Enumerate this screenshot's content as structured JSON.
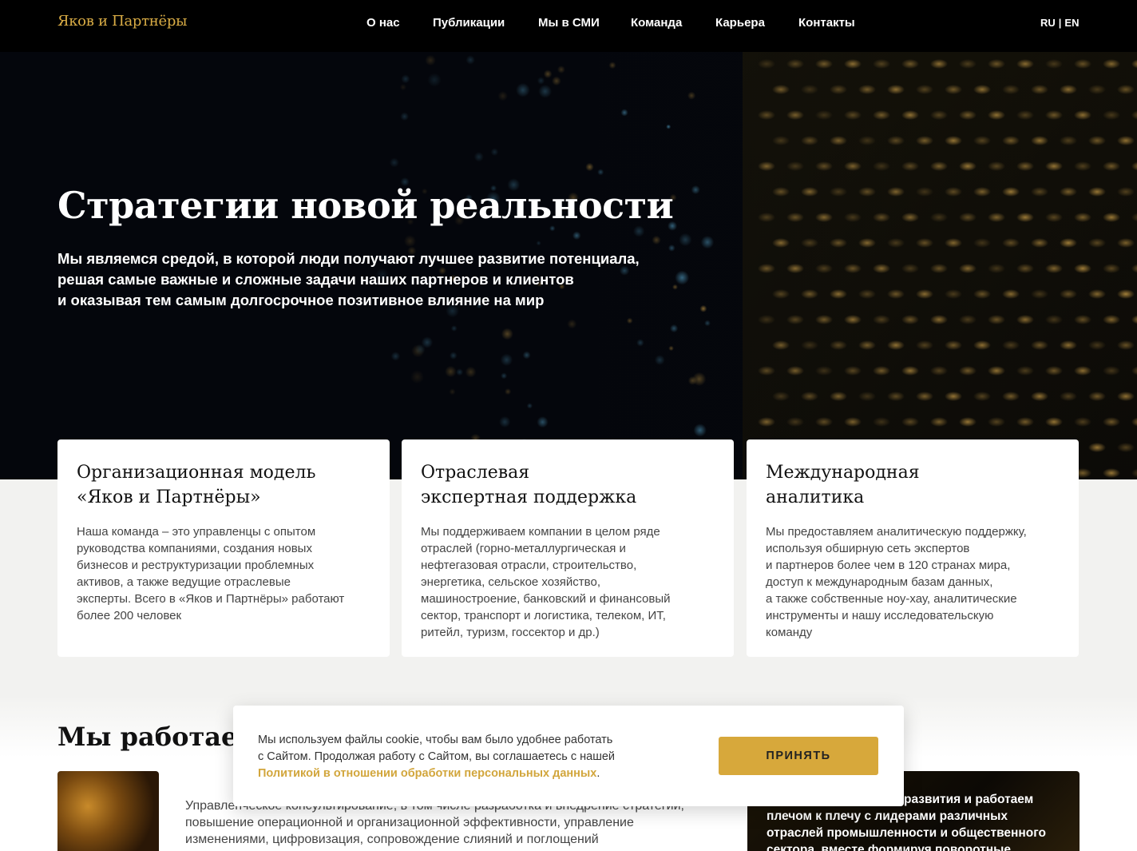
{
  "header": {
    "logo": "Яков и Партнёры",
    "nav": [
      "О нас",
      "Публикации",
      "Мы в СМИ",
      "Команда",
      "Карьера",
      "Контакты"
    ],
    "lang": {
      "ru": "RU",
      "sep": "|",
      "en": "EN"
    }
  },
  "hero": {
    "title": "Стратегии новой реальности",
    "subtitle_lines": [
      "Мы являемся средой, в которой люди получают лучшее развитие потенциала,",
      "решая самые важные и сложные задачи наших партнеров и клиентов",
      "и оказывая тем самым долгосрочное позитивное влияние на мир"
    ]
  },
  "cards": [
    {
      "title_lines": [
        "Организационная модель",
        "«Яков и Партнёры»"
      ],
      "text_lines": [
        "Наша команда – это управленцы с опытом",
        "руководства компаниями, создания новых",
        "бизнесов и реструктуризации проблемных",
        "активов, а также ведущие отраслевые",
        "эксперты. Всего в «Яков и Партнёры» работают",
        "более 200 человек"
      ]
    },
    {
      "title_lines": [
        "Отраслевая",
        "экспертная поддержка"
      ],
      "text_lines": [
        "Мы поддерживаем компании в целом ряде",
        "отраслей (горно-металлургическая и",
        "нефтегазовая отрасли, строительство,",
        "энергетика, сельское хозяйство,",
        "машиностроение, банковский и финансовый",
        "сектор, транспорт и логистика, телеком, ИТ,",
        "ритейл, туризм, госсектор и др.)"
      ]
    },
    {
      "title_lines": [
        "Международная",
        "аналитика"
      ],
      "text_lines": [
        "Мы предоставляем аналитическую поддержку,",
        "используя обширную сеть экспертов",
        "и партнеров более чем в 120 странах мира,",
        "доступ к международным базам данных,",
        "а также собственные ноу-хау, аналитические",
        "инструменты и нашу исследовательскую",
        "команду"
      ]
    }
  ],
  "section": {
    "title": "Мы работаем п",
    "text_lines": [
      "Управленческое консультирование, в том числе разработка и внедрение стратегии,",
      "повышение операционной и организационной эффективности, управление",
      "изменениями, цифровизация, сопровождение слияний и поглощений"
    ],
    "dark_lines": [
      "развития и работаем",
      "плечом к плечу с лидерами различных",
      "отраслей промышленности и общественного",
      "сектора, вместе формируя поворотные"
    ]
  },
  "cookie": {
    "line1": "Мы используем файлы cookie, чтобы вам было удобнее работать",
    "line2": "с Сайтом. Продолжая работу с Сайтом, вы соглашаетесь с нашей",
    "link": "Политикой в отношении обработки персональных данных",
    "period": ".",
    "accept": "ПРИНЯТЬ"
  }
}
